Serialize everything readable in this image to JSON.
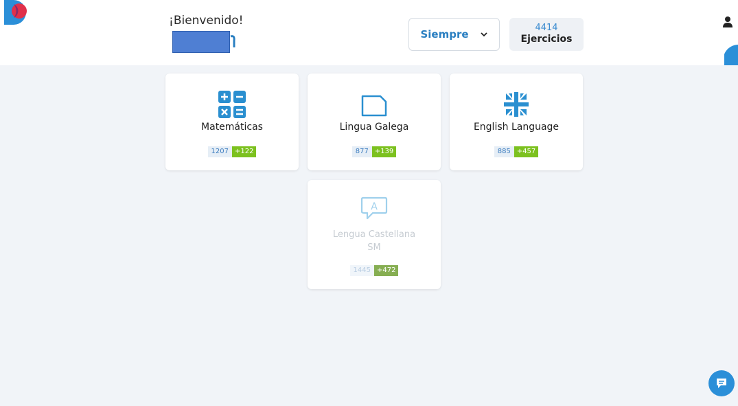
{
  "header": {
    "welcome": "¡Bienvenido!",
    "range_filter": {
      "selected": "Siempre"
    },
    "exercises": {
      "count": "4414",
      "label": "Ejercicios"
    }
  },
  "subjects": [
    {
      "name": "Matemáticas",
      "count": "1207",
      "new": "+122",
      "icon": "calculator-icon",
      "enabled": true
    },
    {
      "name": "Lingua Galega",
      "count": "877",
      "new": "+139",
      "icon": "page-icon",
      "enabled": true
    },
    {
      "name": "English Language",
      "count": "885",
      "new": "+457",
      "icon": "uk-flag-icon",
      "enabled": true
    },
    {
      "name": "Lengua Castellana SM",
      "count": "1445",
      "new": "+472",
      "icon": "speech-bubble-a-icon",
      "enabled": false
    }
  ],
  "colors": {
    "accent": "#2a7fc1",
    "new_badge": "#7cc11f",
    "background": "#f1f4f8",
    "logo_blue": "#2b8fd8",
    "logo_red": "#e0304a"
  }
}
